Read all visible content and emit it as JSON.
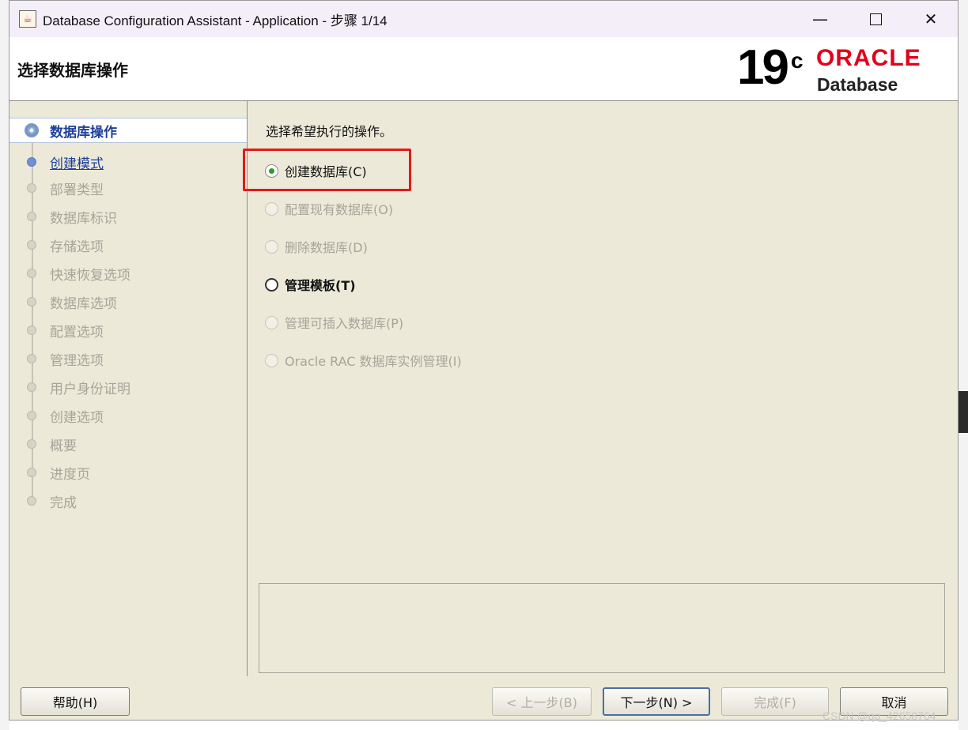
{
  "window": {
    "title": "Database Configuration Assistant - Application - 步骤 1/14",
    "minimize": "—",
    "close": "✕"
  },
  "header": {
    "page_title": "选择数据库操作",
    "logo_version": "19",
    "logo_superscript": "c",
    "logo_brand": "ORACLE",
    "logo_product": "Database"
  },
  "sidebar": {
    "steps": [
      {
        "label": "数据库操作"
      },
      {
        "label": "创建模式"
      },
      {
        "label": "部署类型"
      },
      {
        "label": "数据库标识"
      },
      {
        "label": "存储选项"
      },
      {
        "label": "快速恢复选项"
      },
      {
        "label": "数据库选项"
      },
      {
        "label": "配置选项"
      },
      {
        "label": "管理选项"
      },
      {
        "label": "用户身份证明"
      },
      {
        "label": "创建选项"
      },
      {
        "label": "概要"
      },
      {
        "label": "进度页"
      },
      {
        "label": "完成"
      }
    ]
  },
  "main": {
    "prompt": "选择希望执行的操作。",
    "options": [
      {
        "label": "创建数据库(C)",
        "checked": true,
        "enabled": true
      },
      {
        "label": "配置现有数据库(O)",
        "checked": false,
        "enabled": false
      },
      {
        "label": "删除数据库(D)",
        "checked": false,
        "enabled": false
      },
      {
        "label": "管理模板(T)",
        "checked": false,
        "enabled": true
      },
      {
        "label": "管理可插入数据库(P)",
        "checked": false,
        "enabled": false
      },
      {
        "label": "Oracle RAC 数据库实例管理(I)",
        "checked": false,
        "enabled": false
      }
    ]
  },
  "footer": {
    "help": "帮助(H)",
    "back": "< 上一步(B)",
    "next": "下一步(N) >",
    "finish": "完成(F)",
    "cancel": "取消"
  },
  "watermark": "CSDN @qq_42658764",
  "colors": {
    "panel_bg": "#ece9d8",
    "accent_step": "#1f3f99",
    "highlight": "#e11a1a",
    "oracle_red": "#e3001b"
  }
}
